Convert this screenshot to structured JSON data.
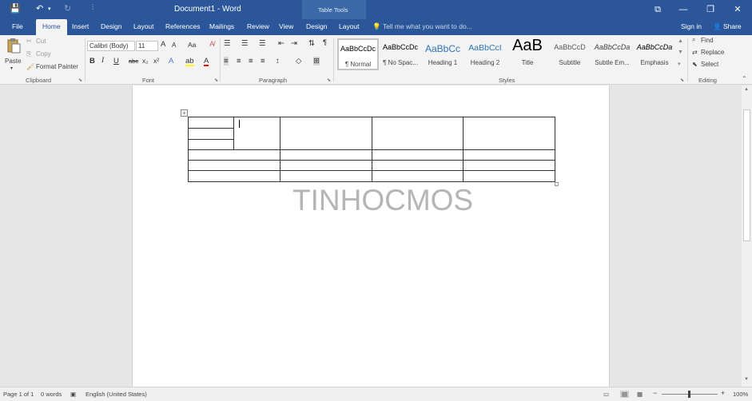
{
  "titlebar": {
    "doc_title": "Document1 - Word",
    "context_label": "Table Tools",
    "save_icon": "💾",
    "undo_icon": "↶",
    "undo_drop": "▾",
    "redo_icon": "↻",
    "qat_more": "⫶",
    "ribbon_display_icon": "⧉",
    "minimize": "—",
    "restore": "❐",
    "close": "✕"
  },
  "tabs": [
    "File",
    "Home",
    "Insert",
    "Design",
    "Layout",
    "References",
    "Mailings",
    "Review",
    "View",
    "Design",
    "Layout"
  ],
  "tellme": "Tell me what you want to do...",
  "signin": "Sign in",
  "share": "Share",
  "clipboard": {
    "paste": "Paste",
    "cut": "Cut",
    "copy": "Copy",
    "format_painter": "Format Painter",
    "group": "Clipboard"
  },
  "font": {
    "family": "Calibri (Body)",
    "size": "11",
    "grow": "A",
    "shrink": "A",
    "case": "Aa",
    "bold": "B",
    "italic": "I",
    "underline": "U",
    "strike": "abc",
    "subscript": "x₂",
    "superscript": "x²",
    "group": "Font"
  },
  "paragraph": {
    "group": "Paragraph",
    "pilcrow": "¶"
  },
  "styles": {
    "group": "Styles",
    "items": [
      {
        "sample": "AaBbCcDc",
        "name": "¶ Normal"
      },
      {
        "sample": "AaBbCcDc",
        "name": "¶ No Spac..."
      },
      {
        "sample": "AaBbCc",
        "name": "Heading 1"
      },
      {
        "sample": "AaBbCcI",
        "name": "Heading 2"
      },
      {
        "sample": "AaB",
        "name": "Title"
      },
      {
        "sample": "AaBbCcD",
        "name": "Subtitle"
      },
      {
        "sample": "AaBbCcDa",
        "name": "Subtle Em..."
      },
      {
        "sample": "AaBbCcDa",
        "name": "Emphasis"
      }
    ]
  },
  "editing": {
    "find": "Find",
    "replace": "Replace",
    "select": "Select",
    "group": "Editing"
  },
  "document": {
    "watermark": "TINHOCMOS",
    "table_handle": "+"
  },
  "status": {
    "page": "Page 1 of 1",
    "words": "0 words",
    "language": "English (United States)",
    "zoom_minus": "−",
    "zoom_plus": "+",
    "zoom": "100%"
  },
  "colors": {
    "title_bar": "#2b579a",
    "ribbon": "#f3f3f3",
    "canvas": "#e6e6e6",
    "highlight": "#ffff00",
    "font_color": "#ff0000"
  }
}
